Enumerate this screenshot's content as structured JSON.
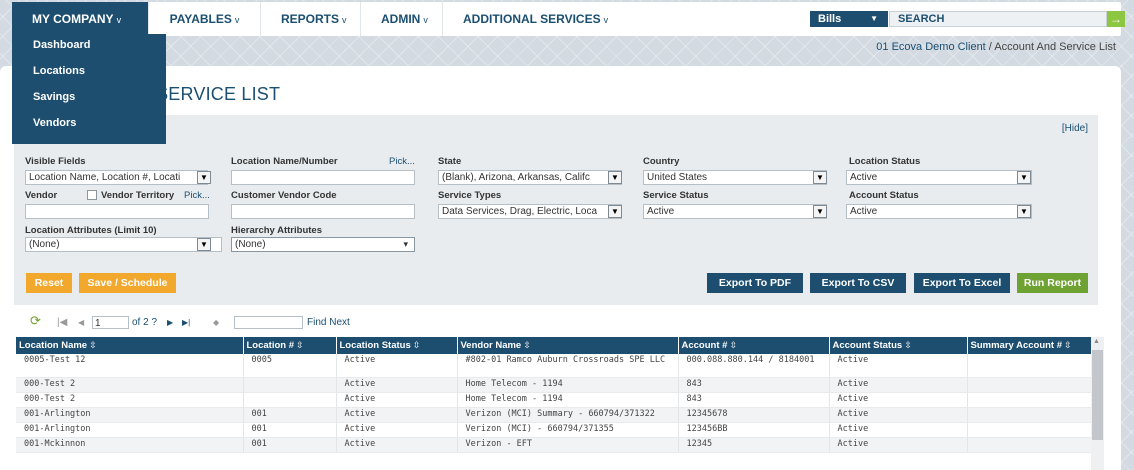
{
  "nav": {
    "items": [
      {
        "label": "MY COMPANY",
        "chevron": "v"
      },
      {
        "label": "PAYABLES",
        "chevron": "v"
      },
      {
        "label": "REPORTS",
        "chevron": "v"
      },
      {
        "label": "ADMIN",
        "chevron": "v"
      },
      {
        "label": "ADDITIONAL SERVICES",
        "chevron": "v"
      }
    ],
    "search_scope": "Bills",
    "search_placeholder": "SEARCH",
    "search_go": "→"
  },
  "dropdown": {
    "items": [
      "Dashboard",
      "Locations",
      "Savings",
      "Vendors"
    ]
  },
  "breadcrumb": {
    "client": "01 Ecova Demo Client",
    "separator": " / ",
    "current": "Account And Service List"
  },
  "page": {
    "title": "ACCOUNT AND SERVICE LIST"
  },
  "filters": {
    "hide_label": "[Hide]",
    "visible_fields": {
      "label": "Visible Fields",
      "value": "Location Name, Location #, Locati"
    },
    "location_name": {
      "label": "Location Name/Number",
      "pick": "Pick...",
      "value": ""
    },
    "state": {
      "label": "State",
      "value": "(Blank), Arizona, Arkansas, Califc"
    },
    "country": {
      "label": "Country",
      "value": "United States"
    },
    "location_status": {
      "label": "Location Status",
      "value": "Active"
    },
    "vendor": {
      "label": "Vendor",
      "value": ""
    },
    "vendor_territory": {
      "label": "Vendor Territory",
      "pick": "Pick..."
    },
    "customer_vendor_code": {
      "label": "Customer Vendor Code",
      "value": ""
    },
    "service_types": {
      "label": "Service Types",
      "value": "Data Services, Drag, Electric, Loca"
    },
    "service_status": {
      "label": "Service Status",
      "value": "Active"
    },
    "account_status": {
      "label": "Account Status",
      "value": "Active"
    },
    "location_attributes": {
      "label": "Location Attributes (Limit 10)",
      "value": "(None)"
    },
    "hierarchy_attributes": {
      "label": "Hierarchy Attributes",
      "value": "(None)"
    },
    "dropdown_glyph": "▼",
    "small_dropdown_glyph": "▾"
  },
  "buttons": {
    "reset": "Reset",
    "save_schedule": "Save / Schedule",
    "export_pdf": "Export To PDF",
    "export_csv": "Export To CSV",
    "export_excel": "Export To Excel",
    "run_report": "Run Report"
  },
  "pager": {
    "refresh": "⟳",
    "first": "|◀",
    "prev": "◀",
    "page": "1",
    "of_pages": "of 2 ?",
    "next": "▶",
    "last": "▶|",
    "find_prev": "◆",
    "find_input": "",
    "find_next": "Find Next"
  },
  "table": {
    "sort_glyph": "⇳",
    "columns": [
      "Location Name",
      "Location #",
      "Location Status",
      "Vendor Name",
      "Account #",
      "Account Status",
      "Summary Account #"
    ],
    "rows": [
      [
        "0005-Test 12",
        "0005",
        "Active",
        "#802-01 Ramco Auburn Crossroads SPE LLC",
        "000.088.880.144 / 8184001",
        "Active",
        ""
      ],
      [
        "000-Test 2",
        "",
        "Active",
        "Home Telecom - 1194",
        "843",
        "Active",
        ""
      ],
      [
        "000-Test 2",
        "",
        "Active",
        "Home Telecom - 1194",
        "843",
        "Active",
        ""
      ],
      [
        "001-Arlington",
        "001",
        "Active",
        "Verizon (MCI) Summary - 660794/371322",
        "12345678",
        "Active",
        ""
      ],
      [
        "001-Arlington",
        "001",
        "Active",
        "Verizon (MCI) - 660794/371355",
        "123456BB",
        "Active",
        ""
      ],
      [
        "001-Mckinnon",
        "001",
        "Active",
        "Verizon - EFT",
        "12345",
        "Active",
        ""
      ]
    ]
  }
}
